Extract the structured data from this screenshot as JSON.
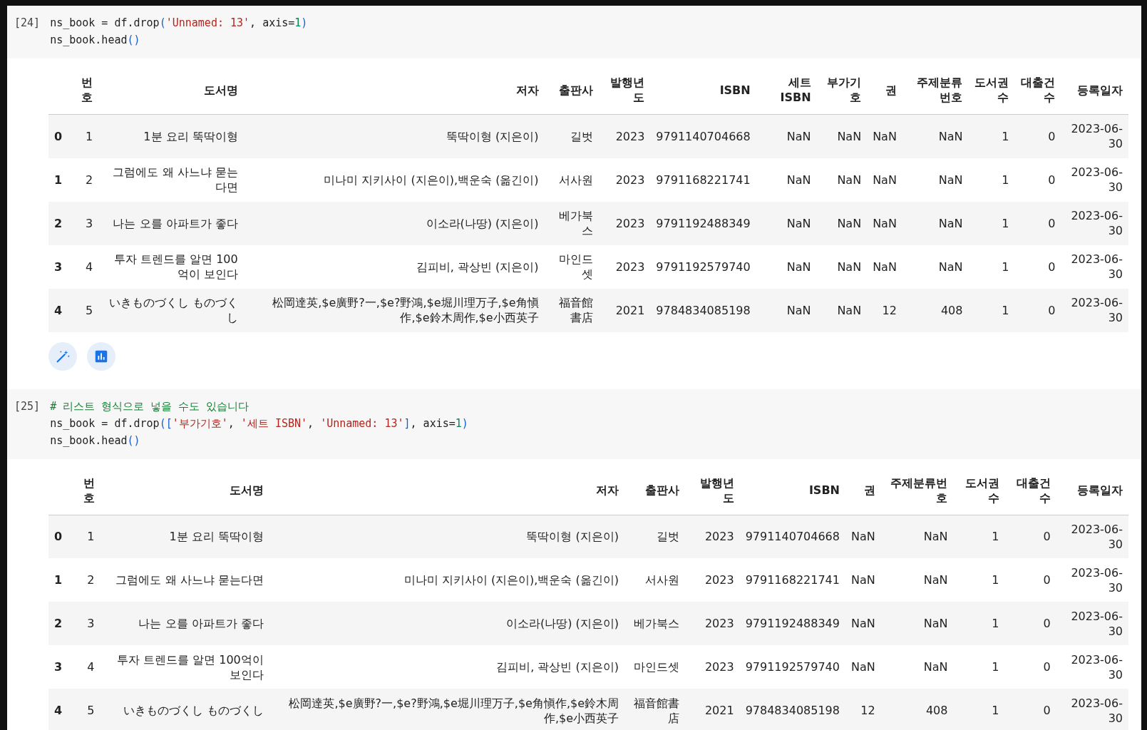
{
  "cells": [
    {
      "exec_count": "[24]",
      "code_lines": [
        [
          {
            "kind": "plain",
            "text": "ns_book = df.drop"
          },
          {
            "kind": "bracket",
            "text": "("
          },
          {
            "kind": "string",
            "text": "'Unnamed: 13'"
          },
          {
            "kind": "plain",
            "text": ", axis="
          },
          {
            "kind": "number",
            "text": "1"
          },
          {
            "kind": "bracket",
            "text": ")"
          }
        ],
        [
          {
            "kind": "plain",
            "text": "ns_book.head"
          },
          {
            "kind": "bracket",
            "text": "()"
          }
        ]
      ],
      "output_actions": [
        {
          "kind": "wand"
        },
        {
          "kind": "chart"
        }
      ],
      "table": {
        "columns": [
          "번호",
          "도서명",
          "저자",
          "출판사",
          "발행년도",
          "ISBN",
          "세트 ISBN",
          "부가기호",
          "권",
          "주제분류번호",
          "도서권수",
          "대출건수",
          "등록일자"
        ],
        "rows": [
          {
            "index": "0",
            "cells": [
              "1",
              "1분 요리 뚝딱이형",
              "뚝딱이형 (지은이)",
              "길벗",
              "2023",
              "9791140704668",
              "NaN",
              "NaN",
              "NaN",
              "NaN",
              "1",
              "0",
              "2023-06-30"
            ]
          },
          {
            "index": "1",
            "cells": [
              "2",
              "그럼에도 왜 사느냐 묻는다면",
              "미나미 지키사이 (지은이),백운숙 (옮긴이)",
              "서사원",
              "2023",
              "9791168221741",
              "NaN",
              "NaN",
              "NaN",
              "NaN",
              "1",
              "0",
              "2023-06-30"
            ]
          },
          {
            "index": "2",
            "cells": [
              "3",
              "나는 오를 아파트가 좋다",
              "이소라(나땅) (지은이)",
              "베가북스",
              "2023",
              "9791192488349",
              "NaN",
              "NaN",
              "NaN",
              "NaN",
              "1",
              "0",
              "2023-06-30"
            ]
          },
          {
            "index": "3",
            "cells": [
              "4",
              "투자 트렌드를 알면 100억이 보인다",
              "김피비, 곽상빈 (지은이)",
              "마인드셋",
              "2023",
              "9791192579740",
              "NaN",
              "NaN",
              "NaN",
              "NaN",
              "1",
              "0",
              "2023-06-30"
            ]
          },
          {
            "index": "4",
            "cells": [
              "5",
              "いきものづくし ものづくし",
              "松岡達英,$e廣野?一,$e?野鴻,$e堀川理万子,$e角愼作,$e鈴木周作,$e小西英子",
              "福音館書店",
              "2021",
              "9784834085198",
              "NaN",
              "NaN",
              "12",
              "408",
              "1",
              "0",
              "2023-06-30"
            ]
          }
        ]
      }
    },
    {
      "exec_count": "[25]",
      "code_lines": [
        [
          {
            "kind": "comment",
            "text": "# 리스트 형식으로 넣을 수도 있습니다"
          }
        ],
        [
          {
            "kind": "plain",
            "text": "ns_book = df.drop"
          },
          {
            "kind": "bracket",
            "text": "("
          },
          {
            "kind": "bracket",
            "text": "["
          },
          {
            "kind": "string",
            "text": "'부가기호'"
          },
          {
            "kind": "plain",
            "text": ", "
          },
          {
            "kind": "string",
            "text": "'세트 ISBN'"
          },
          {
            "kind": "plain",
            "text": ", "
          },
          {
            "kind": "string",
            "text": "'Unnamed: 13'"
          },
          {
            "kind": "bracket",
            "text": "]"
          },
          {
            "kind": "plain",
            "text": ", axis="
          },
          {
            "kind": "number",
            "text": "1"
          },
          {
            "kind": "bracket",
            "text": ")"
          }
        ],
        [
          {
            "kind": "plain",
            "text": "ns_book.head"
          },
          {
            "kind": "bracket",
            "text": "()"
          }
        ]
      ],
      "table": {
        "columns": [
          "번호",
          "도서명",
          "저자",
          "출판사",
          "발행년도",
          "ISBN",
          "권",
          "주제분류번호",
          "도서권수",
          "대출건수",
          "등록일자"
        ],
        "rows": [
          {
            "index": "0",
            "cells": [
              "1",
              "1분 요리 뚝딱이형",
              "뚝딱이형 (지은이)",
              "길벗",
              "2023",
              "9791140704668",
              "NaN",
              "NaN",
              "1",
              "0",
              "2023-06-30"
            ]
          },
          {
            "index": "1",
            "cells": [
              "2",
              "그럼에도 왜 사느냐 묻는다면",
              "미나미 지키사이 (지은이),백운숙 (옮긴이)",
              "서사원",
              "2023",
              "9791168221741",
              "NaN",
              "NaN",
              "1",
              "0",
              "2023-06-30"
            ]
          },
          {
            "index": "2",
            "cells": [
              "3",
              "나는 오를 아파트가 좋다",
              "이소라(나땅) (지은이)",
              "베가북스",
              "2023",
              "9791192488349",
              "NaN",
              "NaN",
              "1",
              "0",
              "2023-06-30"
            ]
          },
          {
            "index": "3",
            "cells": [
              "4",
              "투자 트렌드를 알면 100억이 보인다",
              "김피비, 곽상빈 (지은이)",
              "마인드셋",
              "2023",
              "9791192579740",
              "NaN",
              "NaN",
              "1",
              "0",
              "2023-06-30"
            ]
          },
          {
            "index": "4",
            "cells": [
              "5",
              "いきものづくし ものづくし",
              "松岡達英,$e廣野?一,$e?野鴻,$e堀川理万子,$e角愼作,$e鈴木周作,$e小西英子",
              "福音館書店",
              "2021",
              "9784834085198",
              "12",
              "408",
              "1",
              "0",
              "2023-06-30"
            ]
          }
        ]
      }
    }
  ]
}
